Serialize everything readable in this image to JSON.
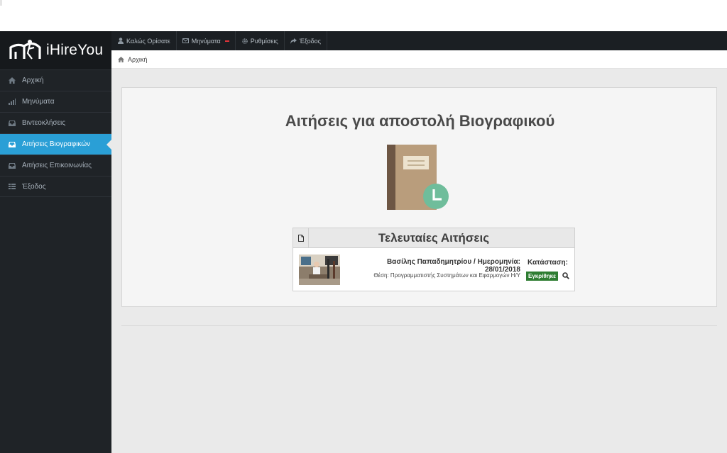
{
  "app": {
    "brand": "iHireYou"
  },
  "sidebar": {
    "items": [
      {
        "label": "Αρχική",
        "icon": "home-icon",
        "active": false
      },
      {
        "label": "Μηνύματα",
        "icon": "signal-icon",
        "active": false
      },
      {
        "label": "Βιντεοκλήσεις",
        "icon": "inbox-icon",
        "active": false
      },
      {
        "label": "Αιτήσεις Βιογραφικών",
        "icon": "inbox-icon",
        "active": true
      },
      {
        "label": "Αιτήσεις Επικοινωνίας",
        "icon": "inbox-icon",
        "active": false
      },
      {
        "label": "Έξοδος",
        "icon": "grid-icon",
        "active": false
      }
    ]
  },
  "topbar": {
    "welcome": "Καλώς Ορίσατε",
    "messages": "Μηνύματα",
    "settings": "Ρυθμίσεις",
    "logout": "Έξοδος"
  },
  "breadcrumb": {
    "home": "Αρχική"
  },
  "main": {
    "title": "Αιτήσεις για αποστολή Βιογραφικού",
    "recent": {
      "title": "Τελευταίες Αιτήσεις",
      "row": {
        "name_date": "Βασίλης Παπαδημητρίου / Ημερομηνία: 28/01/2018",
        "position": "Θέση: Προγραμματιστής Συστημάτων και Εφαρμογών Η/Υ",
        "status_label": "Κατάσταση:",
        "status_value": "Εγκρίθηκε"
      }
    }
  },
  "colors": {
    "sidebar_bg": "#1f2327",
    "active_item": "#2a9fd6",
    "approved_badge": "#2e7d32",
    "notification_badge": "#e0343a"
  }
}
